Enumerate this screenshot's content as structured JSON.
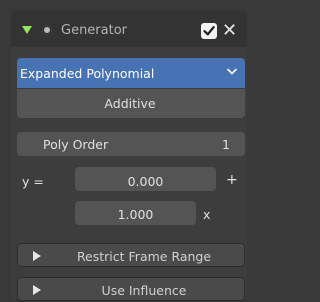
{
  "header": {
    "title": "Generator",
    "enabled_checked": true,
    "accent_color": "#94e35a",
    "icons": [
      "expand-triangle-icon",
      "modifier-dot-icon",
      "checkbox-icon",
      "close-icon"
    ]
  },
  "mode": {
    "selected": "Expanded Polynomial",
    "additive_label": "Additive"
  },
  "poly_order": {
    "label": "Poly Order",
    "value": "1"
  },
  "equation": {
    "y_label": "y =",
    "coefficients": [
      "0.000",
      "1.000"
    ],
    "plus": "+",
    "x_var": "x"
  },
  "subpanels": [
    {
      "label": "Restrict Frame Range"
    },
    {
      "label": "Use Influence"
    }
  ],
  "colors": {
    "dropdown_bg": "#4772b3",
    "field_bg": "#545454",
    "panel_bg": "#3d3d3d"
  }
}
